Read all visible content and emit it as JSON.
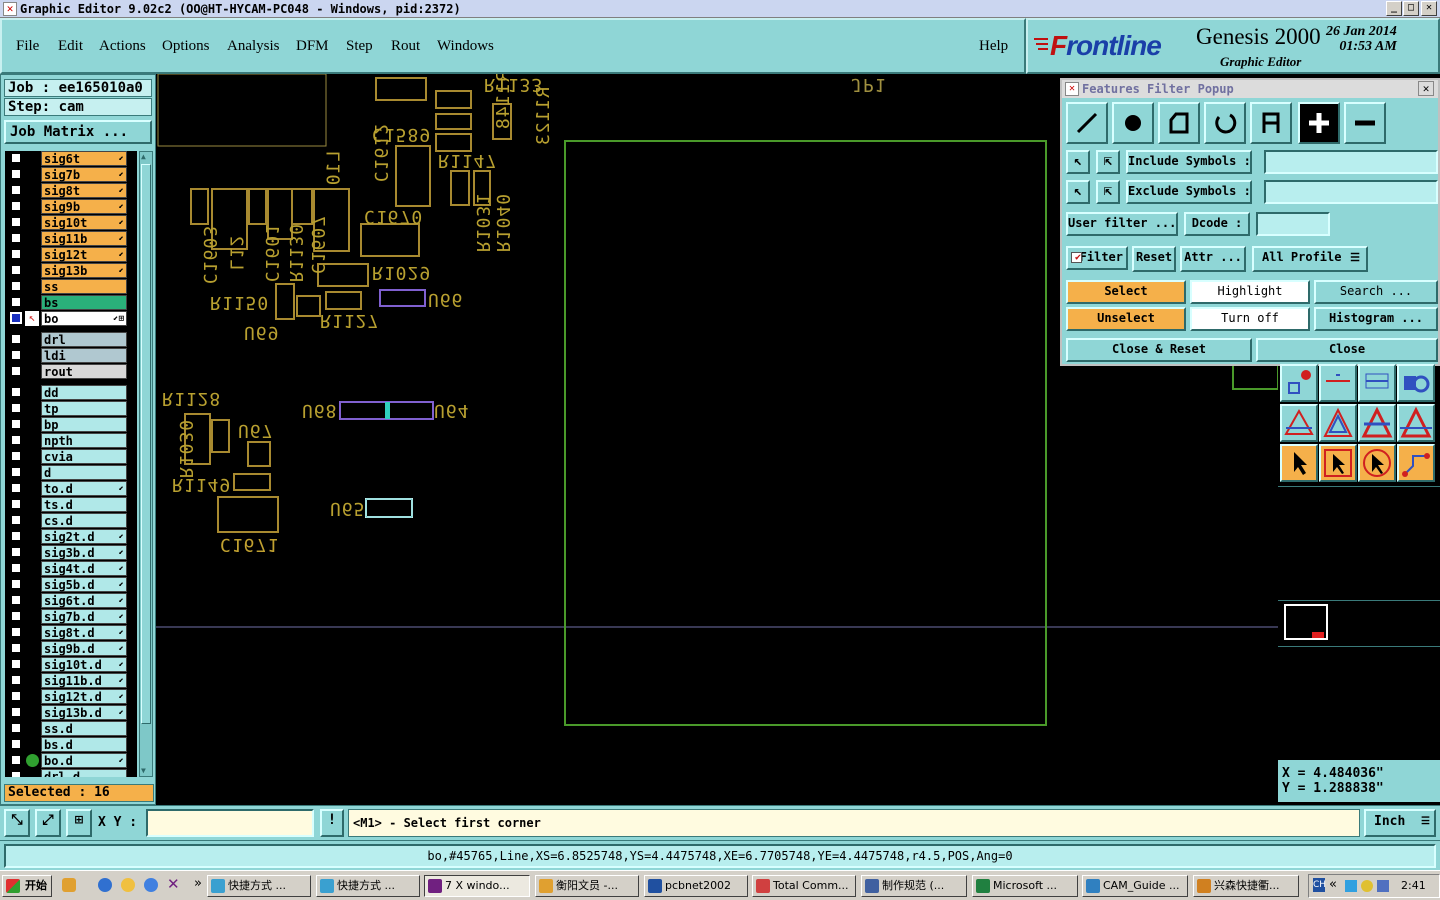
{
  "window": {
    "title": "Graphic Editor 9.02c2 (OO@HT-HYCAM-PC048 - Windows, pid:2372)",
    "controls": {
      "minimize": "_",
      "maximize": "□",
      "close": "✕"
    }
  },
  "menu": [
    "File",
    "Edit",
    "Actions",
    "Options",
    "Analysis",
    "DFM",
    "Step",
    "Rout",
    "Windows"
  ],
  "help": "Help",
  "brand": {
    "logo_f": "F",
    "logo_rest": "rontline",
    "product": "Genesis 2000",
    "subtitle": "Graphic Editor",
    "date": "26 Jan 2014",
    "time": "01:53 AM"
  },
  "job": {
    "job_label": "Job : ee165010a0",
    "step_label": "Step: cam",
    "matrix_button": "Job Matrix ..."
  },
  "layers": [
    {
      "name": "sig6t",
      "color": "#f5b04a",
      "arrow": true
    },
    {
      "name": "sig7b",
      "color": "#f5b04a",
      "arrow": true
    },
    {
      "name": "sig8t",
      "color": "#f5b04a",
      "arrow": true
    },
    {
      "name": "sig9b",
      "color": "#f5b04a",
      "arrow": true
    },
    {
      "name": "sig10t",
      "color": "#f5b04a",
      "arrow": true
    },
    {
      "name": "sig11b",
      "color": "#f5b04a",
      "arrow": true
    },
    {
      "name": "sig12t",
      "color": "#f5b04a",
      "arrow": true
    },
    {
      "name": "sig13b",
      "color": "#f5b04a",
      "arrow": true
    },
    {
      "name": "ss",
      "color": "#f5b04a",
      "arrow": false
    },
    {
      "name": "bs",
      "color": "#2ab07a",
      "arrow": false
    },
    {
      "name": "bo",
      "color": "#ffffff",
      "arrow": true,
      "active": true
    },
    {
      "name": "drl",
      "color": "#b0c8d0",
      "arrow": false,
      "gap": true
    },
    {
      "name": "ldi",
      "color": "#b0c8d0",
      "arrow": false
    },
    {
      "name": "rout",
      "color": "#d8d8d8",
      "arrow": false
    },
    {
      "name": "dd",
      "color": "#b0e8e8",
      "arrow": false,
      "gap": true
    },
    {
      "name": "tp",
      "color": "#b0e8e8",
      "arrow": false
    },
    {
      "name": "bp",
      "color": "#b0e8e8",
      "arrow": false
    },
    {
      "name": "npth",
      "color": "#b0e8e8",
      "arrow": false
    },
    {
      "name": "cvia",
      "color": "#b0e8e8",
      "arrow": false
    },
    {
      "name": "d",
      "color": "#b0e8e8",
      "arrow": false
    },
    {
      "name": "to.d",
      "color": "#b0e8e8",
      "arrow": true
    },
    {
      "name": "ts.d",
      "color": "#b0e8e8",
      "arrow": false
    },
    {
      "name": "cs.d",
      "color": "#b0e8e8",
      "arrow": false
    },
    {
      "name": "sig2t.d",
      "color": "#b0e8e8",
      "arrow": true
    },
    {
      "name": "sig3b.d",
      "color": "#b0e8e8",
      "arrow": true
    },
    {
      "name": "sig4t.d",
      "color": "#b0e8e8",
      "arrow": true
    },
    {
      "name": "sig5b.d",
      "color": "#b0e8e8",
      "arrow": true
    },
    {
      "name": "sig6t.d",
      "color": "#b0e8e8",
      "arrow": true
    },
    {
      "name": "sig7b.d",
      "color": "#b0e8e8",
      "arrow": true
    },
    {
      "name": "sig8t.d",
      "color": "#b0e8e8",
      "arrow": true
    },
    {
      "name": "sig9b.d",
      "color": "#b0e8e8",
      "arrow": true
    },
    {
      "name": "sig10t.d",
      "color": "#b0e8e8",
      "arrow": true
    },
    {
      "name": "sig11b.d",
      "color": "#b0e8e8",
      "arrow": true
    },
    {
      "name": "sig12t.d",
      "color": "#b0e8e8",
      "arrow": true
    },
    {
      "name": "sig13b.d",
      "color": "#b0e8e8",
      "arrow": true
    },
    {
      "name": "ss.d",
      "color": "#b0e8e8",
      "arrow": false
    },
    {
      "name": "bs.d",
      "color": "#b0e8e8",
      "arrow": false
    },
    {
      "name": "bo.d",
      "color": "#b0e8e8",
      "arrow": true,
      "dot": true
    },
    {
      "name": "drl.d",
      "color": "#b0e8e8",
      "arrow": false
    }
  ],
  "selected": "Selected : 16",
  "canvas": {
    "labels": [
      "R1133",
      "R1148",
      "R1123",
      "C1589",
      "C1612",
      "R1147",
      "L10",
      "R1031",
      "R1040",
      "C1670",
      "C1603",
      "L12",
      "C1601",
      "R1130",
      "C1607",
      "R1029",
      "R1150",
      "U66",
      "R1127",
      "U69",
      "R1128",
      "U68",
      "U64",
      "R1030",
      "U67",
      "R1149",
      "U65",
      "C1671",
      "JP1"
    ]
  },
  "filter_popup": {
    "title": "Features Filter Popup",
    "include_label": "Include Symbols :",
    "exclude_label": "Exclude Symbols :",
    "include_value": "",
    "exclude_value": "",
    "user_filter": "User filter ...",
    "dcode_label": "Dcode :",
    "dcode_value": "",
    "filter_toggle": "Filter",
    "reset": "Reset",
    "attr": "Attr ...",
    "profile": "All Profile",
    "select": "Select",
    "highlight": "Highlight",
    "search": "Search ...",
    "unselect": "Unselect",
    "turn_off": "Turn off",
    "histogram": "Histogram ...",
    "close_reset": "Close & Reset",
    "close": "Close",
    "type_icons": [
      "line-icon",
      "pad-icon",
      "surface-icon",
      "arc-icon",
      "text-icon",
      "positive-icon",
      "negative-icon"
    ]
  },
  "coords": {
    "x": "X = 4.484036\"",
    "y": "Y = 1.288838\""
  },
  "command": {
    "xy_label": "X Y :",
    "xy_value": "",
    "message": "<M1> - Select first corner",
    "units": "Inch"
  },
  "status": "bo,#45765,Line,XS=6.8525748,YS=4.4475748,XE=6.7705748,YE=4.4475748,r4.5,POS,Ang=0",
  "taskbar": {
    "start": "开始",
    "more": "»",
    "tasks": [
      "快捷方式 ...",
      "快捷方式 ...",
      "7 X windo...",
      "衡阳文员 -...",
      "pcbnet2002",
      "Total Comm...",
      "制作规范 (...",
      "Microsoft ...",
      "CAM_Guide ...",
      "兴森快捷衢..."
    ],
    "tray_chevron": "«",
    "clock": "2:41"
  }
}
